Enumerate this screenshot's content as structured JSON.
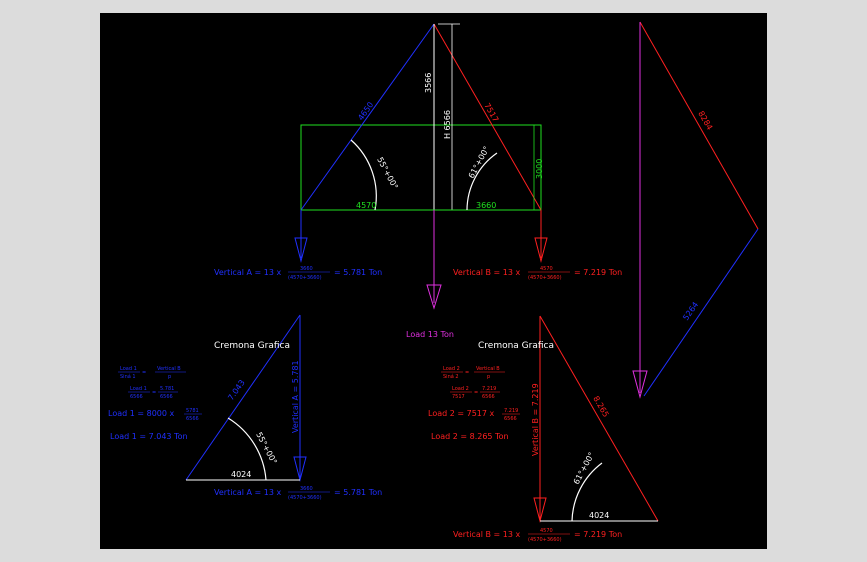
{
  "colors": {
    "background": "#000000",
    "frame": "#dcdcdc",
    "blue": "#2030ff",
    "red": "#ff2020",
    "green": "#20e020",
    "magenta": "#e030e0",
    "white": "#ffffff"
  },
  "truss": {
    "left_member": "4650",
    "right_member": "7517",
    "vertical_upper": "3566",
    "height_label": "H 6566",
    "left_base": "4570",
    "right_base": "3660",
    "green_height": "3000",
    "angle_left": "55°+00°",
    "angle_right": "61°+00°",
    "far_top": "8284",
    "far_bottom": "5264"
  },
  "equations": {
    "vertical_a_top": {
      "lhs": "Vertical A = 13 x",
      "num": "3660",
      "den": "(4570+3660)",
      "rhs": "= 5.781 Ton"
    },
    "vertical_b_top": {
      "lhs": "Vertical B = 13 x",
      "num": "4570",
      "den": "(4570+3660)",
      "rhs": "= 7.219 Ton"
    },
    "load_center": "Load 13 Ton"
  },
  "left_panel": {
    "title": "Cremona Grafica",
    "ratio1_num_l": "Load 1",
    "ratio1_den_l": "Siná 1",
    "ratio1_num_r": "Vertical B",
    "ratio1_den_r": "p",
    "ratio2_num_l": "Load 1",
    "ratio2_den_l": "6566",
    "ratio2_num_r": "5.781",
    "ratio2_den_r": "6566",
    "load_line1": "Load 1 = 8000 x",
    "load_line1_num": "5781",
    "load_line1_den": "6566",
    "load_result": "Load 1 = 7.043 Ton",
    "hyp": "7.043",
    "vert": "Vertical A = 5.781",
    "angle": "55°+00°",
    "base": "4024",
    "bottom_eq": {
      "lhs": "Vertical A = 13 x",
      "num": "3660",
      "den": "(4570+3660)",
      "rhs": "= 5.781 Ton"
    }
  },
  "right_panel": {
    "title": "Cremona Grafica",
    "ratio1_num_l": "Load 2",
    "ratio1_den_l": "Siná 2",
    "ratio1_num_r": "Vertical B",
    "ratio1_den_r": "p",
    "ratio2_num_l": "Load 2",
    "ratio2_den_l": "7517",
    "ratio2_num_r": "7.219",
    "ratio2_den_r": "6566",
    "load_line1": "Load 2 = 7517 x",
    "load_line1_num": "7.219",
    "load_line1_den": "6566",
    "load_result": "Load 2 = 8.265 Ton",
    "hyp": "8.265",
    "vert": "Vertical B = 7.219",
    "angle": "61°+00°",
    "base": "4024",
    "bottom_eq": {
      "lhs": "Vertical B = 13 x",
      "num": "4570",
      "den": "(4570+3660)",
      "rhs": "= 7.219 Ton"
    }
  }
}
